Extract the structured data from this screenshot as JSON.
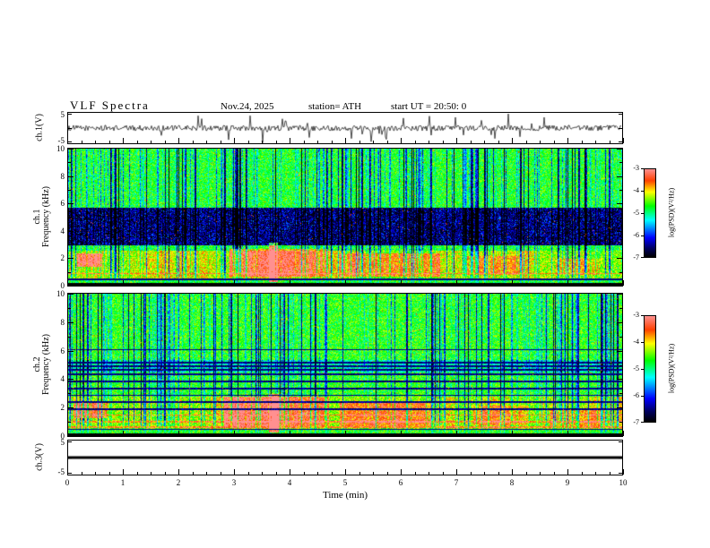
{
  "header": {
    "title": "VLF Spectra",
    "date": "Nov.24, 2025",
    "station": "station= ATH",
    "start_ut": "start UT =  20:50: 0"
  },
  "xaxis": {
    "label": "Time (min)",
    "range": [
      0,
      10
    ],
    "ticks": [
      0,
      1,
      2,
      3,
      4,
      5,
      6,
      7,
      8,
      9,
      10
    ]
  },
  "colormap_stops": [
    [
      0.0,
      0,
      0,
      0
    ],
    [
      0.1,
      0,
      0,
      96
    ],
    [
      0.22,
      0,
      0,
      255
    ],
    [
      0.42,
      0,
      255,
      255
    ],
    [
      0.58,
      0,
      255,
      0
    ],
    [
      0.74,
      255,
      255,
      0
    ],
    [
      0.87,
      255,
      64,
      0
    ],
    [
      1.0,
      255,
      144,
      144
    ]
  ],
  "chart_data": [
    {
      "type": "line",
      "name": "ch1-voltage-waveform",
      "ylabel": "ch.1(V)",
      "ylim": [
        -5,
        5
      ],
      "yticks": [
        5,
        -5
      ],
      "description": "Noisy broadband voltage trace around 0 V with impulsive spikes (sferics) up to about ±4 V",
      "seed": 1234,
      "noise_v": 0.9,
      "spike_prob": 0.05,
      "flat": false
    },
    {
      "type": "heatmap",
      "name": "ch1-spectrogram",
      "ylabel_lines": [
        "ch.1",
        "Frequency (kHz)"
      ],
      "ylim": [
        0,
        10
      ],
      "yticks": [
        10,
        8,
        6,
        4,
        2,
        0
      ],
      "value_range": [
        -7,
        -3
      ],
      "colorbar": {
        "label": "log(PSD)(V²/Hz)",
        "ticks": [
          -3,
          -4,
          -5,
          -6,
          -7
        ]
      },
      "features": {
        "background_log_psd": -4.7,
        "vertical_streaks": {
          "probability": 0.36,
          "strong_probability": 0.17
        },
        "dark_band": {
          "f0": 3.0,
          "f1": 5.7,
          "delta": -1.9
        },
        "dim_band": null,
        "hot_band": {
          "f0": 0.55,
          "f1": 2.6,
          "delta": 0.6
        },
        "hot_regions": [
          {
            "t0": 0.15,
            "t1": 0.6,
            "f0": 1.4,
            "f1": 2.4,
            "delta": 1.5
          },
          {
            "t0": 2.9,
            "t1": 4.7,
            "f0": 0.7,
            "f1": 2.7,
            "delta": 1.0
          },
          {
            "t0": 3.62,
            "t1": 3.78,
            "f0": 0.3,
            "f1": 3.2,
            "delta": 2.0
          },
          {
            "t0": 4.9,
            "t1": 6.7,
            "f0": 0.7,
            "f1": 2.4,
            "delta": 0.9
          },
          {
            "t0": 7.2,
            "t1": 8.2,
            "f0": 0.8,
            "f1": 2.2,
            "delta": 0.6
          },
          {
            "t0": 8.8,
            "t1": 9.6,
            "f0": 0.8,
            "f1": 2.0,
            "delta": 0.5
          }
        ],
        "harmonic_lines": [],
        "bright_lines": [
          0.9
        ],
        "black_floor_khz": 0.25,
        "dark_line_khz": 0.5,
        "speckle_hot_prob": 0.004,
        "seed": 99
      }
    },
    {
      "type": "heatmap",
      "name": "ch2-spectrogram",
      "ylabel_lines": [
        "ch.2",
        "Frequency (kHz)"
      ],
      "ylim": [
        0,
        10
      ],
      "yticks": [
        10,
        8,
        6,
        4,
        2,
        0
      ],
      "value_range": [
        -7,
        -3
      ],
      "colorbar": {
        "label": "log(PSD)(V²/Hz)",
        "ticks": [
          -3,
          -4,
          -5,
          -6,
          -7
        ]
      },
      "features": {
        "background_log_psd": -4.65,
        "vertical_streaks": {
          "probability": 0.36,
          "strong_probability": 0.16
        },
        "dark_band": null,
        "dim_band": {
          "f0": 4.5,
          "f1": 5.35,
          "delta": -0.55
        },
        "hot_band": {
          "f0": 0.45,
          "f1": 2.8,
          "delta": 0.65
        },
        "hot_regions": [
          {
            "t0": 0.1,
            "t1": 0.7,
            "f0": 1.3,
            "f1": 2.5,
            "delta": 1.2
          },
          {
            "t0": 2.8,
            "t1": 4.7,
            "f0": 0.7,
            "f1": 2.8,
            "delta": 1.1
          },
          {
            "t0": 3.62,
            "t1": 3.8,
            "f0": 0.3,
            "f1": 3.0,
            "delta": 1.9
          },
          {
            "t0": 4.9,
            "t1": 6.6,
            "f0": 0.7,
            "f1": 2.5,
            "delta": 0.9
          },
          {
            "t0": 7.3,
            "t1": 8.3,
            "f0": 0.8,
            "f1": 2.2,
            "delta": 0.6
          },
          {
            "t0": 8.7,
            "t1": 9.7,
            "f0": 0.7,
            "f1": 2.0,
            "delta": 0.55
          }
        ],
        "harmonic_lines": [
          1.9,
          2.4,
          2.9,
          3.35,
          3.85,
          4.35,
          4.7,
          4.95,
          5.2,
          6.1
        ],
        "bright_lines": [
          0.65,
          1.05,
          1.5
        ],
        "black_floor_khz": 0.25,
        "dark_line_khz": 0.5,
        "speckle_hot_prob": 0.004,
        "seed": 777
      }
    },
    {
      "type": "line",
      "name": "ch3-voltage-waveform",
      "ylabel": "ch.3(V)",
      "ylim": [
        -5,
        5
      ],
      "yticks": [
        5,
        -5
      ],
      "description": "Flat (zero) trace drawn as a thick black line",
      "seed": 5,
      "noise_v": 0,
      "spike_prob": 0,
      "flat": true
    }
  ]
}
